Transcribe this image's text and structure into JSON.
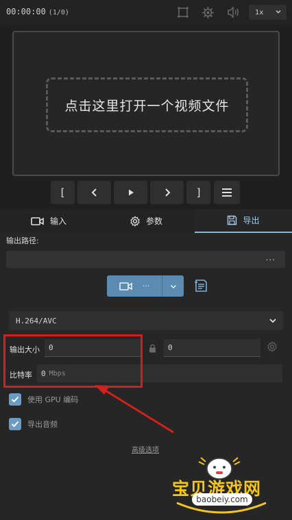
{
  "player": {
    "timecode": "00:00:00",
    "frame_counter": "(1/0)",
    "speed": "1x",
    "open_prompt": "点击这里打开一个视频文件"
  },
  "controls": {
    "mark_in": "[",
    "mark_out": "]"
  },
  "tabs": [
    {
      "label": "输入",
      "icon": "video-camera-icon"
    },
    {
      "label": "参数",
      "icon": "gear-icon"
    },
    {
      "label": "导出",
      "icon": "save-icon",
      "active": true
    }
  ],
  "export": {
    "output_path_label": "输出路径:",
    "output_path_value": "",
    "browse_label": "...",
    "export_dots": "···",
    "codec": "H.264/AVC",
    "output_size_label": "输出大小",
    "width_value": "0",
    "height_value": "0",
    "bitrate_label": "比特率",
    "bitrate_value": "0",
    "bitrate_unit": "Mbps",
    "use_gpu_label": "使用 GPU 编码",
    "use_gpu_checked": true,
    "export_audio_label": "导出音频",
    "export_audio_checked": true,
    "advanced_label": "高级选项"
  },
  "watermark": {
    "name": "宝贝游戏网",
    "domain": "baobeiy.com"
  },
  "colors": {
    "accent": "#5b8bb0",
    "annotation": "#d2201c",
    "watermark": "#f4c51d"
  }
}
